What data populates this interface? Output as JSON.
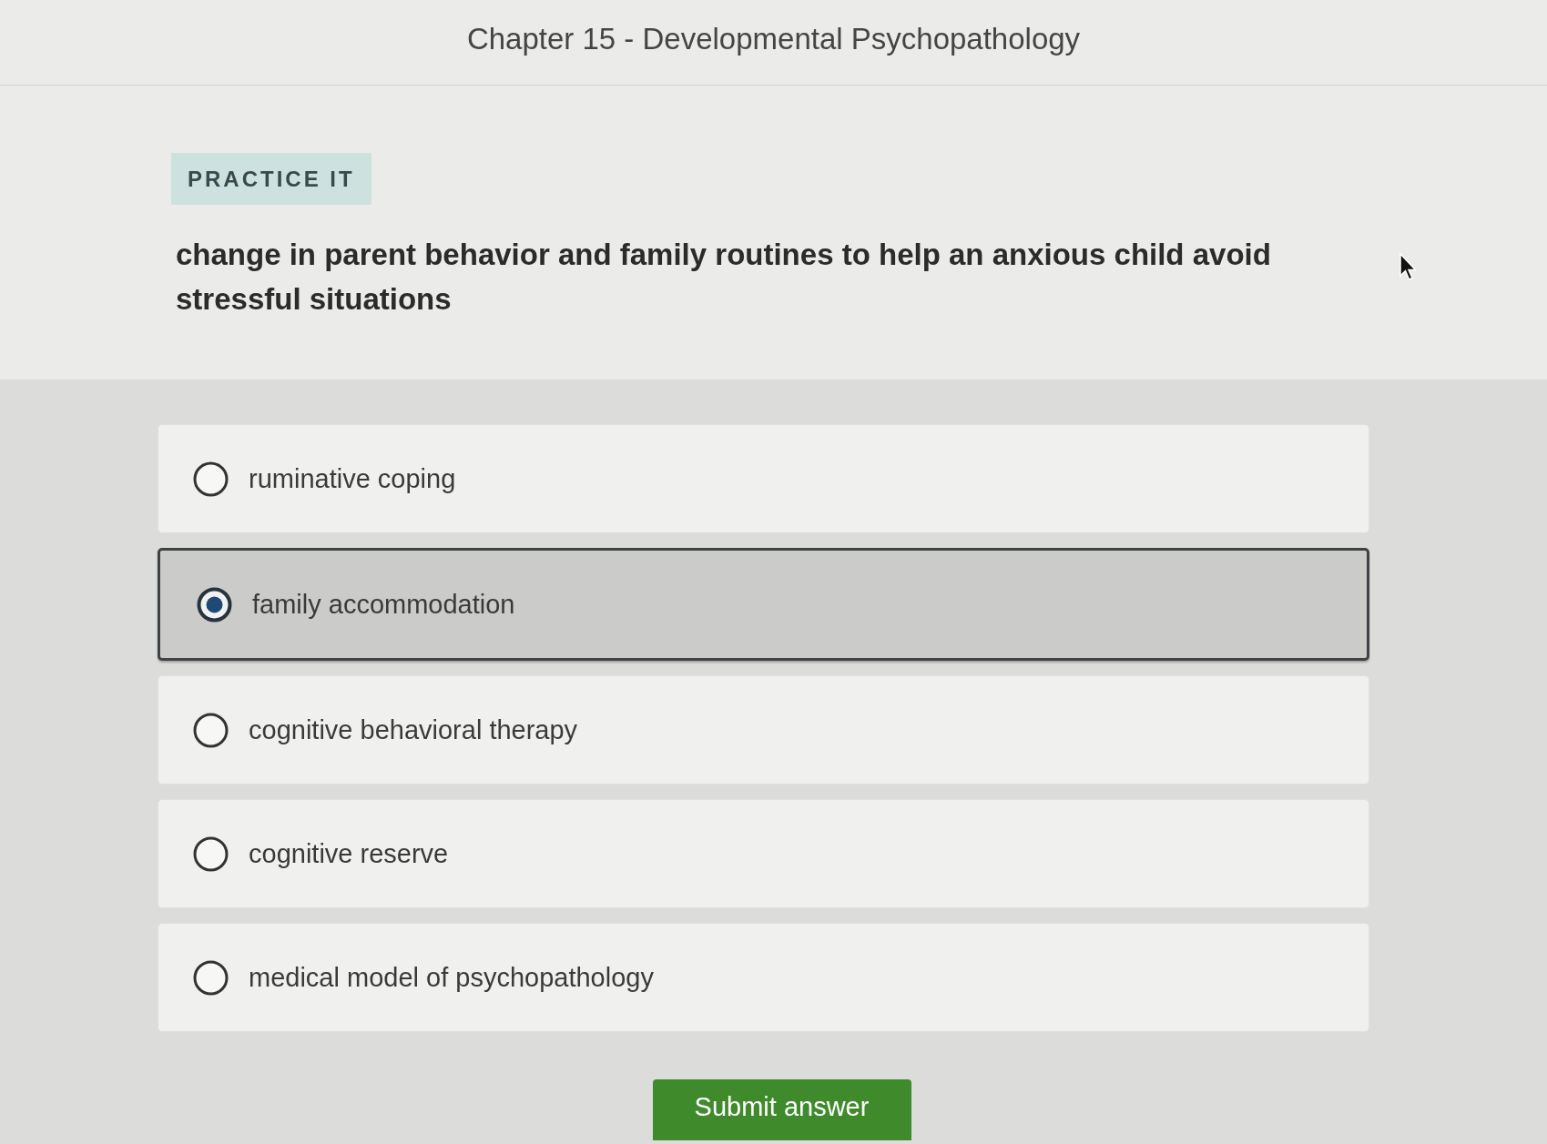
{
  "header": {
    "title": "Chapter 15 - Developmental Psychopathology"
  },
  "badge": {
    "label": "PRACTICE IT"
  },
  "question": {
    "text": "change in parent behavior and family routines to help an anxious child avoid stressful situations"
  },
  "options": [
    {
      "label": "ruminative coping",
      "selected": false
    },
    {
      "label": "family accommodation",
      "selected": true
    },
    {
      "label": "cognitive behavioral therapy",
      "selected": false
    },
    {
      "label": "cognitive reserve",
      "selected": false
    },
    {
      "label": "medical model of psychopathology",
      "selected": false
    }
  ],
  "submit_button": {
    "label": "Submit answer"
  }
}
